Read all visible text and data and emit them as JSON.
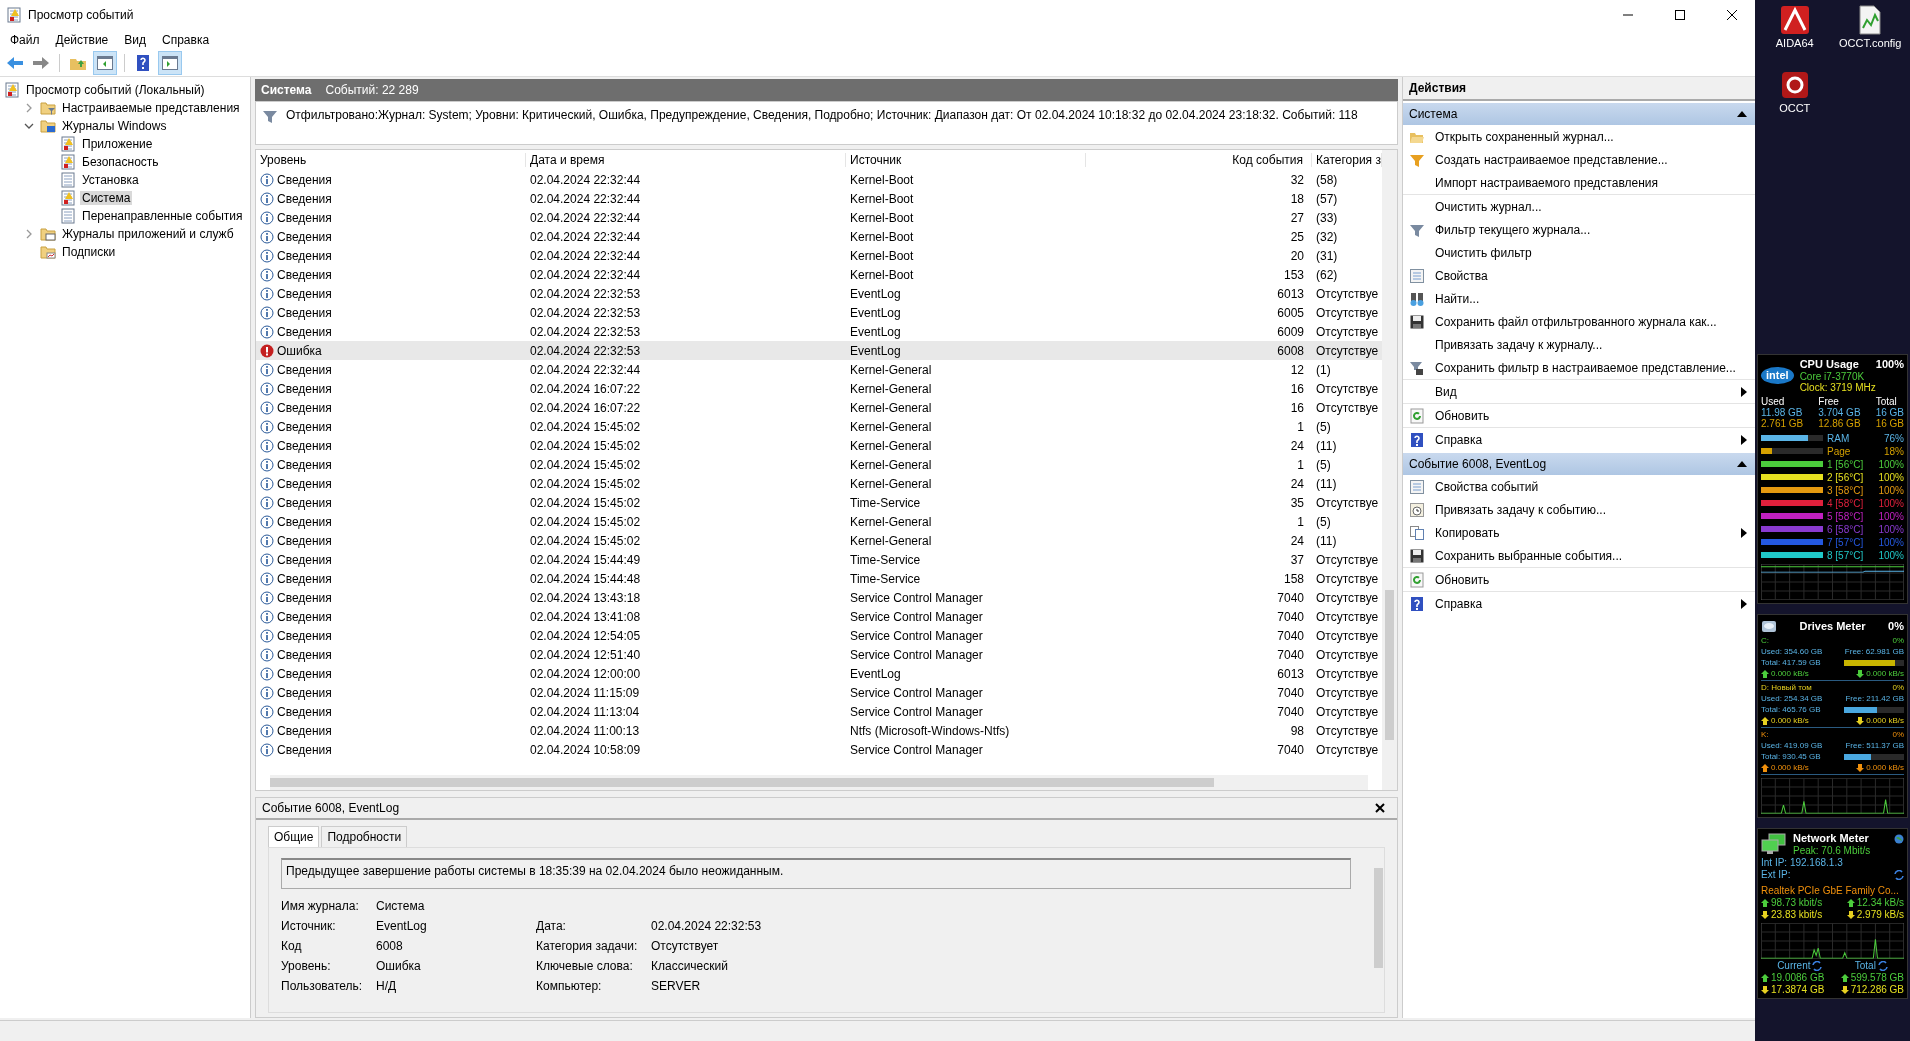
{
  "window": {
    "title": "Просмотр событий"
  },
  "menu": [
    "Файл",
    "Действие",
    "Вид",
    "Справка"
  ],
  "tree": [
    {
      "label": "Просмотр событий (Локальный)",
      "kind": "root",
      "selected": false,
      "children": [
        {
          "label": "Настраиваемые представления",
          "kind": "folder-filter",
          "selected": false,
          "expanded": false
        },
        {
          "label": "Журналы Windows",
          "kind": "folder-windows",
          "selected": false,
          "expanded": true,
          "children": [
            {
              "label": "Приложение",
              "kind": "log-warn",
              "selected": false
            },
            {
              "label": "Безопасность",
              "kind": "log-warn",
              "selected": false
            },
            {
              "label": "Установка",
              "kind": "log",
              "selected": false
            },
            {
              "label": "Система",
              "kind": "log-warn",
              "selected": true
            },
            {
              "label": "Перенаправленные события",
              "kind": "log",
              "selected": false
            }
          ]
        },
        {
          "label": "Журналы приложений и служб",
          "kind": "folder-app",
          "selected": false,
          "expanded": false
        },
        {
          "label": "Подписки",
          "kind": "folder-sub",
          "selected": false
        }
      ]
    }
  ],
  "log_header": {
    "title": "Система",
    "count": "Событий: 22 289"
  },
  "filter": "Отфильтровано:Журнал: System; Уровни: Критический, Ошибка, Предупреждение, Сведения, Подробно; Источник: Диапазон дат: От 02.04.2024 10:18:32 до 02.04.2024 23:18:32. Событий: 118",
  "table": {
    "columns": [
      "Уровень",
      "Дата и время",
      "Источник",
      "Код события",
      "Категория з"
    ],
    "rows": [
      {
        "kind": "info",
        "level": "Сведения",
        "date": "02.04.2024 22:32:44",
        "source": "Kernel-Boot",
        "code": "32",
        "category": "(58)",
        "selected": false
      },
      {
        "kind": "info",
        "level": "Сведения",
        "date": "02.04.2024 22:32:44",
        "source": "Kernel-Boot",
        "code": "18",
        "category": "(57)",
        "selected": false
      },
      {
        "kind": "info",
        "level": "Сведения",
        "date": "02.04.2024 22:32:44",
        "source": "Kernel-Boot",
        "code": "27",
        "category": "(33)",
        "selected": false
      },
      {
        "kind": "info",
        "level": "Сведения",
        "date": "02.04.2024 22:32:44",
        "source": "Kernel-Boot",
        "code": "25",
        "category": "(32)",
        "selected": false
      },
      {
        "kind": "info",
        "level": "Сведения",
        "date": "02.04.2024 22:32:44",
        "source": "Kernel-Boot",
        "code": "20",
        "category": "(31)",
        "selected": false
      },
      {
        "kind": "info",
        "level": "Сведения",
        "date": "02.04.2024 22:32:44",
        "source": "Kernel-Boot",
        "code": "153",
        "category": "(62)",
        "selected": false
      },
      {
        "kind": "info",
        "level": "Сведения",
        "date": "02.04.2024 22:32:53",
        "source": "EventLog",
        "code": "6013",
        "category": "Отсутствуе",
        "selected": false
      },
      {
        "kind": "info",
        "level": "Сведения",
        "date": "02.04.2024 22:32:53",
        "source": "EventLog",
        "code": "6005",
        "category": "Отсутствуе",
        "selected": false
      },
      {
        "kind": "info",
        "level": "Сведения",
        "date": "02.04.2024 22:32:53",
        "source": "EventLog",
        "code": "6009",
        "category": "Отсутствуе",
        "selected": false
      },
      {
        "kind": "error",
        "level": "Ошибка",
        "date": "02.04.2024 22:32:53",
        "source": "EventLog",
        "code": "6008",
        "category": "Отсутствуе",
        "selected": true
      },
      {
        "kind": "info",
        "level": "Сведения",
        "date": "02.04.2024 22:32:44",
        "source": "Kernel-General",
        "code": "12",
        "category": "(1)",
        "selected": false
      },
      {
        "kind": "info",
        "level": "Сведения",
        "date": "02.04.2024 16:07:22",
        "source": "Kernel-General",
        "code": "16",
        "category": "Отсутствуе",
        "selected": false
      },
      {
        "kind": "info",
        "level": "Сведения",
        "date": "02.04.2024 16:07:22",
        "source": "Kernel-General",
        "code": "16",
        "category": "Отсутствуе",
        "selected": false
      },
      {
        "kind": "info",
        "level": "Сведения",
        "date": "02.04.2024 15:45:02",
        "source": "Kernel-General",
        "code": "1",
        "category": "(5)",
        "selected": false
      },
      {
        "kind": "info",
        "level": "Сведения",
        "date": "02.04.2024 15:45:02",
        "source": "Kernel-General",
        "code": "24",
        "category": "(11)",
        "selected": false
      },
      {
        "kind": "info",
        "level": "Сведения",
        "date": "02.04.2024 15:45:02",
        "source": "Kernel-General",
        "code": "1",
        "category": "(5)",
        "selected": false
      },
      {
        "kind": "info",
        "level": "Сведения",
        "date": "02.04.2024 15:45:02",
        "source": "Kernel-General",
        "code": "24",
        "category": "(11)",
        "selected": false
      },
      {
        "kind": "info",
        "level": "Сведения",
        "date": "02.04.2024 15:45:02",
        "source": "Time-Service",
        "code": "35",
        "category": "Отсутствуе",
        "selected": false
      },
      {
        "kind": "info",
        "level": "Сведения",
        "date": "02.04.2024 15:45:02",
        "source": "Kernel-General",
        "code": "1",
        "category": "(5)",
        "selected": false
      },
      {
        "kind": "info",
        "level": "Сведения",
        "date": "02.04.2024 15:45:02",
        "source": "Kernel-General",
        "code": "24",
        "category": "(11)",
        "selected": false
      },
      {
        "kind": "info",
        "level": "Сведения",
        "date": "02.04.2024 15:44:49",
        "source": "Time-Service",
        "code": "37",
        "category": "Отсутствуе",
        "selected": false
      },
      {
        "kind": "info",
        "level": "Сведения",
        "date": "02.04.2024 15:44:48",
        "source": "Time-Service",
        "code": "158",
        "category": "Отсутствуе",
        "selected": false
      },
      {
        "kind": "info",
        "level": "Сведения",
        "date": "02.04.2024 13:43:18",
        "source": "Service Control Manager",
        "code": "7040",
        "category": "Отсутствуе",
        "selected": false
      },
      {
        "kind": "info",
        "level": "Сведения",
        "date": "02.04.2024 13:41:08",
        "source": "Service Control Manager",
        "code": "7040",
        "category": "Отсутствуе",
        "selected": false
      },
      {
        "kind": "info",
        "level": "Сведения",
        "date": "02.04.2024 12:54:05",
        "source": "Service Control Manager",
        "code": "7040",
        "category": "Отсутствуе",
        "selected": false
      },
      {
        "kind": "info",
        "level": "Сведения",
        "date": "02.04.2024 12:51:40",
        "source": "Service Control Manager",
        "code": "7040",
        "category": "Отсутствуе",
        "selected": false
      },
      {
        "kind": "info",
        "level": "Сведения",
        "date": "02.04.2024 12:00:00",
        "source": "EventLog",
        "code": "6013",
        "category": "Отсутствуе",
        "selected": false
      },
      {
        "kind": "info",
        "level": "Сведения",
        "date": "02.04.2024 11:15:09",
        "source": "Service Control Manager",
        "code": "7040",
        "category": "Отсутствуе",
        "selected": false
      },
      {
        "kind": "info",
        "level": "Сведения",
        "date": "02.04.2024 11:13:04",
        "source": "Service Control Manager",
        "code": "7040",
        "category": "Отсутствуе",
        "selected": false
      },
      {
        "kind": "info",
        "level": "Сведения",
        "date": "02.04.2024 11:00:13",
        "source": "Ntfs (Microsoft-Windows-Ntfs)",
        "code": "98",
        "category": "Отсутствуе",
        "selected": false
      },
      {
        "kind": "info",
        "level": "Сведения",
        "date": "02.04.2024 10:58:09",
        "source": "Service Control Manager",
        "code": "7040",
        "category": "Отсутствуе",
        "selected": false
      }
    ]
  },
  "detail": {
    "title": "Событие 6008, EventLog",
    "tabs": [
      {
        "label": "Общие",
        "selected": true
      },
      {
        "label": "Подробности",
        "selected": false
      }
    ],
    "message": "Предыдущее завершение работы системы в 18:35:39 на 02.04.2024 было неожиданным.",
    "fields": [
      {
        "left": {
          "label": "Имя журнала:",
          "value": "Система"
        }
      },
      {
        "left": {
          "label": "Источник:",
          "value": "EventLog"
        },
        "right": {
          "label": "Дата:",
          "value": "02.04.2024 22:32:53"
        }
      },
      {
        "left": {
          "label": "Код",
          "value": "6008"
        },
        "right": {
          "label": "Категория задачи:",
          "value": "Отсутствует"
        }
      },
      {
        "left": {
          "label": "Уровень:",
          "value": "Ошибка"
        },
        "right": {
          "label": "Ключевые слова:",
          "value": "Классический"
        }
      },
      {
        "left": {
          "label": "Пользователь:",
          "value": "Н/Д"
        },
        "right": {
          "label": "Компьютер:",
          "value": "SERVER"
        }
      }
    ]
  },
  "actions": {
    "title": "Действия",
    "sections": [
      {
        "title": "Система",
        "expanded": true,
        "items": [
          {
            "label": "Открыть сохраненный журнал...",
            "kind": "open",
            "submenu": false,
            "separator": false
          },
          {
            "label": "Создать настраиваемое представление...",
            "kind": "filter-new",
            "submenu": false,
            "separator": false
          },
          {
            "label": "Импорт настраиваемого представления",
            "kind": "none",
            "submenu": false,
            "separator": true
          },
          {
            "label": "Очистить журнал...",
            "kind": "none",
            "submenu": false,
            "separator": false
          },
          {
            "label": "Фильтр текущего журнала...",
            "kind": "filter",
            "submenu": false,
            "separator": false
          },
          {
            "label": "Очистить фильтр",
            "kind": "none",
            "submenu": false,
            "separator": false
          },
          {
            "label": "Свойства",
            "kind": "properties",
            "submenu": false,
            "separator": false
          },
          {
            "label": "Найти...",
            "kind": "find",
            "submenu": false,
            "separator": false
          },
          {
            "label": "Сохранить файл отфильтрованного журнала как...",
            "kind": "save",
            "submenu": false,
            "separator": false
          },
          {
            "label": "Привязать задачу к журналу...",
            "kind": "none",
            "submenu": false,
            "separator": false
          },
          {
            "label": "Сохранить фильтр в настраиваемое представление...",
            "kind": "filter-save",
            "submenu": false,
            "separator": true
          },
          {
            "label": "Вид",
            "kind": "none",
            "submenu": true,
            "separator": true
          },
          {
            "label": "Обновить",
            "kind": "refresh",
            "submenu": false,
            "separator": true
          },
          {
            "label": "Справка",
            "kind": "help",
            "submenu": true,
            "separator": false
          }
        ]
      },
      {
        "title": "Событие 6008, EventLog",
        "expanded": true,
        "items": [
          {
            "label": "Свойства событий",
            "kind": "properties",
            "submenu": false,
            "separator": false
          },
          {
            "label": "Привязать задачу к событию...",
            "kind": "task",
            "submenu": false,
            "separator": false
          },
          {
            "label": "Копировать",
            "kind": "copy",
            "submenu": true,
            "separator": false
          },
          {
            "label": "Сохранить выбранные события...",
            "kind": "save",
            "submenu": false,
            "separator": true
          },
          {
            "label": "Обновить",
            "kind": "refresh",
            "submenu": false,
            "separator": true
          },
          {
            "label": "Справка",
            "kind": "help",
            "submenu": true,
            "separator": false
          }
        ]
      }
    ]
  },
  "desktop": {
    "icons": [
      {
        "label": "AIDA64",
        "kind": "aida"
      },
      {
        "label": "OCCT.config",
        "kind": "config"
      },
      {
        "label": "OCCT",
        "kind": "occt"
      }
    ],
    "cpu": {
      "logo": "intel",
      "title": "CPU Usage",
      "value": "100%",
      "model": "Core i7-3770K",
      "clock": "Clock:  3719 MHz",
      "mem_header": [
        "Used",
        "Free",
        "Total"
      ],
      "mem_rows": [
        [
          "11.98 GB",
          "3.704 GB",
          "16 GB"
        ],
        [
          "2.761 GB",
          "12.86 GB",
          "16 GB"
        ]
      ],
      "bars": [
        {
          "label": "RAM",
          "value": "76%",
          "level": 0.76,
          "color": "#5ab4e6"
        },
        {
          "label": "Page",
          "value": "18%",
          "level": 0.18,
          "color": "#d4a000"
        },
        {
          "label": "1 [56°C]",
          "value": "100%",
          "level": 1,
          "color": "#4ccc3c"
        },
        {
          "label": "2 [56°C]",
          "value": "100%",
          "level": 1,
          "color": "#e6e020"
        },
        {
          "label": "3 [58°C]",
          "value": "100%",
          "level": 1,
          "color": "#e69a10"
        },
        {
          "label": "4 [58°C]",
          "value": "100%",
          "level": 1,
          "color": "#e0203c"
        },
        {
          "label": "5 [58°C]",
          "value": "100%",
          "level": 1,
          "color": "#c020c0"
        },
        {
          "label": "6 [58°C]",
          "value": "100%",
          "level": 1,
          "color": "#8a3ad0"
        },
        {
          "label": "7 [57°C]",
          "value": "100%",
          "level": 1,
          "color": "#2458e0"
        },
        {
          "label": "8 [57°C]",
          "value": "100%",
          "level": 1,
          "color": "#20c8c8"
        }
      ]
    },
    "drives": {
      "title": "Drives Meter",
      "value": "0%",
      "items": [
        {
          "name": "C:",
          "value": "0%",
          "used": "Used: 354.60 GB",
          "free": "Free: 62.981 GB",
          "total": "Total: 417.59 GB",
          "level": 0.85,
          "up": "0.000 kB/s",
          "down": "0.000 kB/s",
          "color": "#4ccc3c"
        },
        {
          "name": "D: Новый том",
          "value": "0%",
          "used": "Used: 254.34 GB",
          "free": "Free: 211.42 GB",
          "total": "Total: 465.76 GB",
          "level": 0.55,
          "up": "0.000 kB/s",
          "down": "0.000 kB/s",
          "color": "#e6d020"
        },
        {
          "name": "K:",
          "value": "0%",
          "used": "Used: 419.09 GB",
          "free": "Free: 511.37 GB",
          "total": "Total: 930.45 GB",
          "level": 0.45,
          "up": "0.000 kB/s",
          "down": "0.000 kB/s",
          "color": "#f0900c"
        }
      ]
    },
    "network": {
      "title": "Network Meter",
      "peak": "Peak: 70.6 Mbit/s",
      "int_label": "Int IP:",
      "int_ip": "192.168.1.3",
      "ext_label": "Ext IP:",
      "adapter": "Realtek PCIe GbE Family Co...",
      "rates": [
        [
          "98.73 kbit/s",
          "12.34 kB/s"
        ],
        [
          "23.83 kbit/s",
          "2.979 kB/s"
        ]
      ],
      "totals_header": [
        "Current",
        "Total"
      ],
      "totals": [
        [
          "19.0086 GB",
          "599.578 GB"
        ],
        [
          "17.3874 GB",
          "712.286 GB"
        ]
      ]
    }
  }
}
